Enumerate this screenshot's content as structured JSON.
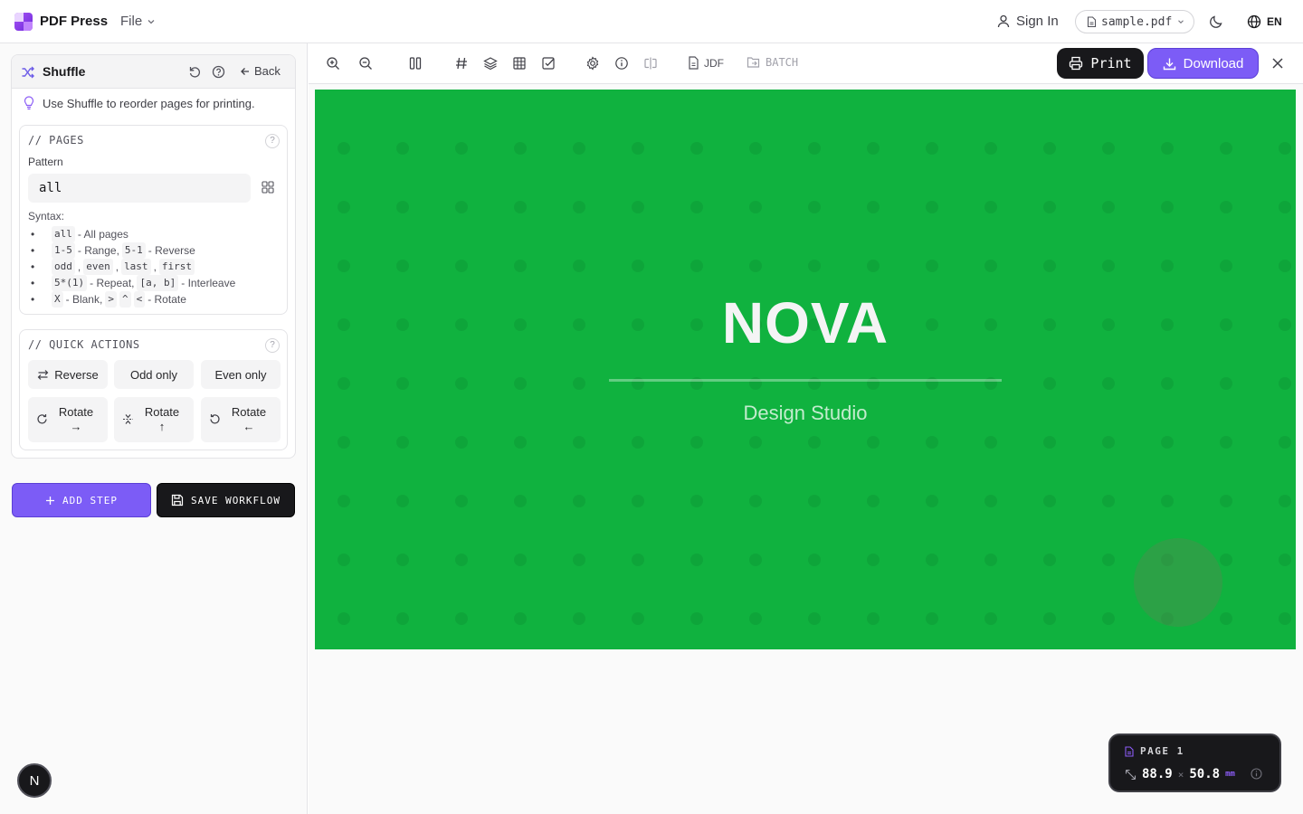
{
  "app": {
    "title": "PDF Press",
    "file_menu": "File",
    "sign_in": "Sign In",
    "file_name": "sample.pdf",
    "language": "EN"
  },
  "tool": {
    "title": "Shuffle",
    "back_label": "Back",
    "tip": "Use Shuffle to reorder pages for printing."
  },
  "pages_section": {
    "title": "// PAGES",
    "pattern_label": "Pattern",
    "pattern_value": "all",
    "syntax_label": "Syntax:",
    "syntax": {
      "all": "all",
      "all_desc": "- All pages",
      "range": "1-5",
      "range_desc": "- Range,",
      "reverse": "5-1",
      "reverse_desc": "- Reverse",
      "odd": "odd",
      "even": "even",
      "last": "last",
      "first": "first",
      "repeat": "5*(1)",
      "repeat_desc": "- Repeat,",
      "interleave": "[a, b]",
      "interleave_desc": "- Interleave",
      "blank": "X",
      "blank_desc": "- Blank,",
      "rot_r": ">",
      "rot_u": "^",
      "rot_l": "<",
      "rotate_desc": "- Rotate",
      "comma": ","
    }
  },
  "quick_actions": {
    "title": "// QUICK ACTIONS",
    "reverse": "Reverse",
    "odd_only": "Odd only",
    "even_only": "Even only",
    "rotate": "Rotate",
    "rotate_right_arrow": "→",
    "rotate_up_arrow": "↑",
    "rotate_left_arrow": "←"
  },
  "actions": {
    "add_step": "ADD STEP",
    "save_workflow": "SAVE WORKFLOW",
    "n_badge": "N"
  },
  "toolbar": {
    "jdf": "JDF",
    "batch": "BATCH",
    "print": "Print",
    "download": "Download"
  },
  "document": {
    "headline": "NOVA",
    "subtitle": "Design Studio",
    "background_color": "#10b23f"
  },
  "page_info": {
    "label": "PAGE 1",
    "width": "88.9",
    "x": "×",
    "height": "50.8",
    "unit": "mm"
  },
  "colors": {
    "accent": "#7c5cf6",
    "dark": "#18181b"
  }
}
